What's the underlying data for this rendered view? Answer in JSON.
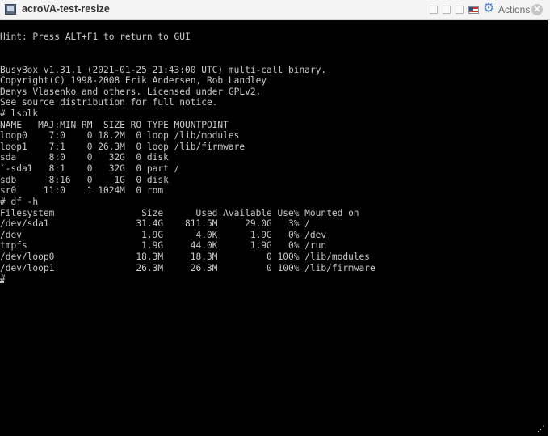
{
  "window": {
    "title": "acroVA-test-resize",
    "actions_label": "Actions",
    "close_glyph": "✕",
    "gear_glyph": "⚙",
    "grip_glyph": "⋰",
    "console_background": "#000000",
    "console_text_color": "#c9c9c9",
    "gear_color": "#4d7fc4"
  },
  "console": {
    "lines": [
      "Hint: Press ALT+F1 to return to GUI",
      "",
      "",
      "",
      "BusyBox v1.31.1 (2021-01-25 21:43:00 UTC) multi-call binary.",
      "Copyright(C) 1998-2008 Erik Andersen, Rob Landley",
      "Denys Vlasenko and others. Licensed under GPLv2.",
      "See source distribution for full notice.",
      "# lsblk",
      "NAME   MAJ:MIN RM  SIZE RO TYPE MOUNTPOINT",
      "loop0    7:0    0 18.2M  0 loop /lib/modules",
      "loop1    7:1    0 26.3M  0 loop /lib/firmware",
      "sda      8:0    0   32G  0 disk",
      "`-sda1   8:1    0   32G  0 part /",
      "sdb      8:16   0    1G  0 disk",
      "sr0     11:0    1 1024M  0 rom",
      "# df -h",
      "Filesystem                Size      Used Available Use% Mounted on",
      "/dev/sda1                31.4G    811.5M     29.0G   3% /",
      "/dev                      1.9G      4.0K      1.9G   0% /dev",
      "tmpfs                     1.9G     44.0K      1.9G   0% /run",
      "/dev/loop0               18.3M     18.3M         0 100% /lib/modules",
      "/dev/loop1               26.3M     26.3M         0 100% /lib/firmware",
      "#"
    ]
  }
}
